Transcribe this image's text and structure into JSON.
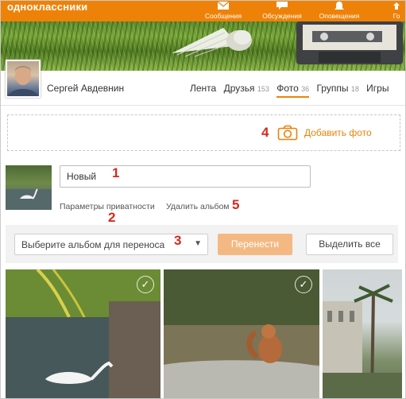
{
  "header": {
    "logo": "одноклассники",
    "nav": [
      {
        "label": "Сообщения",
        "icon": "envelope-icon"
      },
      {
        "label": "Обсуждения",
        "icon": "chat-icon"
      },
      {
        "label": "Оповещения",
        "icon": "bell-icon"
      },
      {
        "label": "Го",
        "icon": "guests-icon"
      }
    ]
  },
  "profile": {
    "name": "Сергей Авдевнин",
    "tabs": [
      {
        "label": "Лента",
        "count": ""
      },
      {
        "label": "Друзья",
        "count": "153"
      },
      {
        "label": "Фото",
        "count": "36"
      },
      {
        "label": "Группы",
        "count": "18"
      },
      {
        "label": "Игры",
        "count": ""
      }
    ]
  },
  "add_photo": {
    "label": "Добавить фото",
    "marker": "4"
  },
  "album": {
    "name_value": "Новый",
    "marker_name": "1",
    "privacy_label": "Параметры приватности",
    "marker_privacy": "2",
    "delete_label": "Удалить альбом",
    "marker_delete": "5"
  },
  "actions": {
    "select_placeholder": "Выберите альбом для переноса",
    "select_arrow": "▼",
    "marker_select": "3",
    "move_label": "Перенести",
    "select_all_label": "Выделить все"
  },
  "colors": {
    "brand": "#ee8208",
    "marker": "#d9281c",
    "move_button": "#f4b983"
  }
}
